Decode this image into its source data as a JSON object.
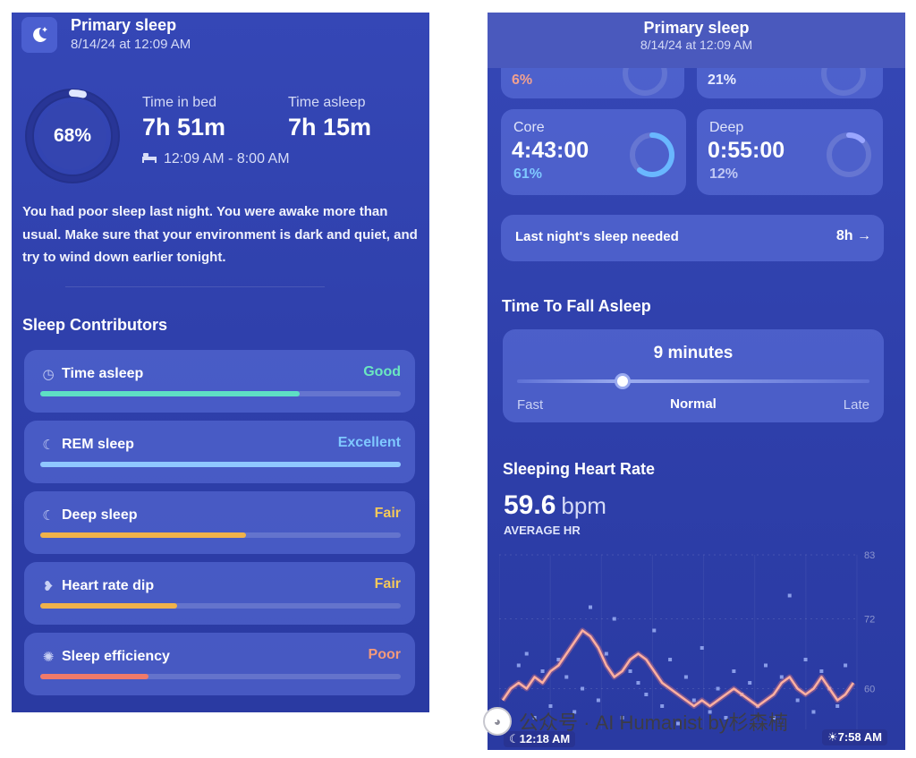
{
  "left": {
    "header": {
      "title": "Primary sleep",
      "date": "8/14/24 at 12:09 AM",
      "icon": "moon-stars-icon"
    },
    "score": {
      "percent_label": "68%",
      "value": 0.68
    },
    "time_in_bed": {
      "label": "Time in bed",
      "value": "7h 51m"
    },
    "time_asleep": {
      "label": "Time asleep",
      "value": "7h 15m"
    },
    "bed_window": {
      "icon": "bed-icon",
      "text": "12:09 AM - 8:00 AM"
    },
    "summary": "You had poor sleep last night. You were awake more than usual. Make sure that your environment is dark and quiet, and try to wind down earlier tonight.",
    "contributors_title": "Sleep Contributors",
    "contributors": [
      {
        "label": "Time asleep",
        "rating": "Good",
        "icon": "clock-icon",
        "level": 0.72,
        "color": "#5ee0c4",
        "rating_color": "#6be7c0"
      },
      {
        "label": "REM sleep",
        "rating": "Excellent",
        "icon": "moon-icon",
        "level": 1.0,
        "color": "#8fc7ff",
        "rating_color": "#7fc8ff"
      },
      {
        "label": "Deep sleep",
        "rating": "Fair",
        "icon": "moon-icon",
        "level": 0.57,
        "color": "#f0b24a",
        "rating_color": "#f4c85a"
      },
      {
        "label": "Heart rate dip",
        "rating": "Fair",
        "icon": "heart-rate-icon",
        "level": 0.38,
        "color": "#f0b24a",
        "rating_color": "#f4c85a"
      },
      {
        "label": "Sleep efficiency",
        "rating": "Poor",
        "icon": "efficiency-icon",
        "level": 0.3,
        "color": "#f07a6a",
        "rating_color": "#f49a7a"
      }
    ]
  },
  "right": {
    "header": {
      "title": "Primary sleep",
      "date": "8/14/24 at 12:09 AM"
    },
    "partial": {
      "left_pct": "6%",
      "right_pct": "21%"
    },
    "stages": [
      {
        "name": "Core",
        "time": "4:43:00",
        "pct_label": "61%",
        "value": 0.61,
        "color": "#69b7ff"
      },
      {
        "name": "Deep",
        "time": "0:55:00",
        "pct_label": "12%",
        "value": 0.12,
        "color": "#9aa6ff"
      }
    ],
    "sleep_needed": {
      "label": "Last night's sleep needed",
      "value": "8h →"
    },
    "fall_asleep": {
      "title": "Time To Fall Asleep",
      "value": "9 minutes",
      "fast": "Fast",
      "normal": "Normal",
      "late": "Late",
      "level": 0.3
    },
    "heart_rate": {
      "title": "Sleeping Heart Rate",
      "value": "59.6",
      "unit": "bpm",
      "sub": "AVERAGE HR",
      "start_time": "☾12:18 AM",
      "end_time": "☀7:58 AM"
    }
  },
  "chart_data": {
    "type": "line",
    "title": "Sleeping Heart Rate",
    "xlabel": "",
    "ylabel": "",
    "x_range": [
      "12:18 AM",
      "7:58 AM"
    ],
    "ylim": [
      53,
      83
    ],
    "y_ticks": [
      83,
      72,
      60
    ],
    "series": [
      {
        "values": [
          58,
          60,
          61,
          60,
          62,
          61,
          63,
          64,
          66,
          68,
          70,
          69,
          67,
          64,
          62,
          63,
          65,
          66,
          65,
          63,
          61,
          60,
          59,
          58,
          57,
          58,
          57,
          58,
          59,
          60,
          59,
          58,
          57,
          58,
          59,
          61,
          62,
          60,
          59,
          60,
          62,
          60,
          58,
          59,
          61
        ]
      }
    ],
    "scatter": [
      [
        2,
        64
      ],
      [
        3,
        66
      ],
      [
        4,
        55
      ],
      [
        5,
        63
      ],
      [
        6,
        57
      ],
      [
        7,
        65
      ],
      [
        8,
        62
      ],
      [
        9,
        56
      ],
      [
        10,
        60
      ],
      [
        11,
        74
      ],
      [
        12,
        58
      ],
      [
        13,
        66
      ],
      [
        14,
        72
      ],
      [
        15,
        55
      ],
      [
        16,
        63
      ],
      [
        17,
        61
      ],
      [
        18,
        59
      ],
      [
        19,
        70
      ],
      [
        20,
        57
      ],
      [
        21,
        65
      ],
      [
        22,
        54
      ],
      [
        23,
        62
      ],
      [
        24,
        58
      ],
      [
        25,
        67
      ],
      [
        26,
        56
      ],
      [
        27,
        60
      ],
      [
        28,
        55
      ],
      [
        29,
        63
      ],
      [
        30,
        59
      ],
      [
        31,
        61
      ],
      [
        32,
        57
      ],
      [
        33,
        64
      ],
      [
        34,
        55
      ],
      [
        35,
        62
      ],
      [
        36,
        76
      ],
      [
        37,
        58
      ],
      [
        38,
        65
      ],
      [
        39,
        56
      ],
      [
        40,
        63
      ],
      [
        41,
        60
      ],
      [
        42,
        57
      ],
      [
        43,
        64
      ]
    ]
  },
  "watermark": {
    "text": "公众号 · AI Humanist by杉森楠"
  }
}
